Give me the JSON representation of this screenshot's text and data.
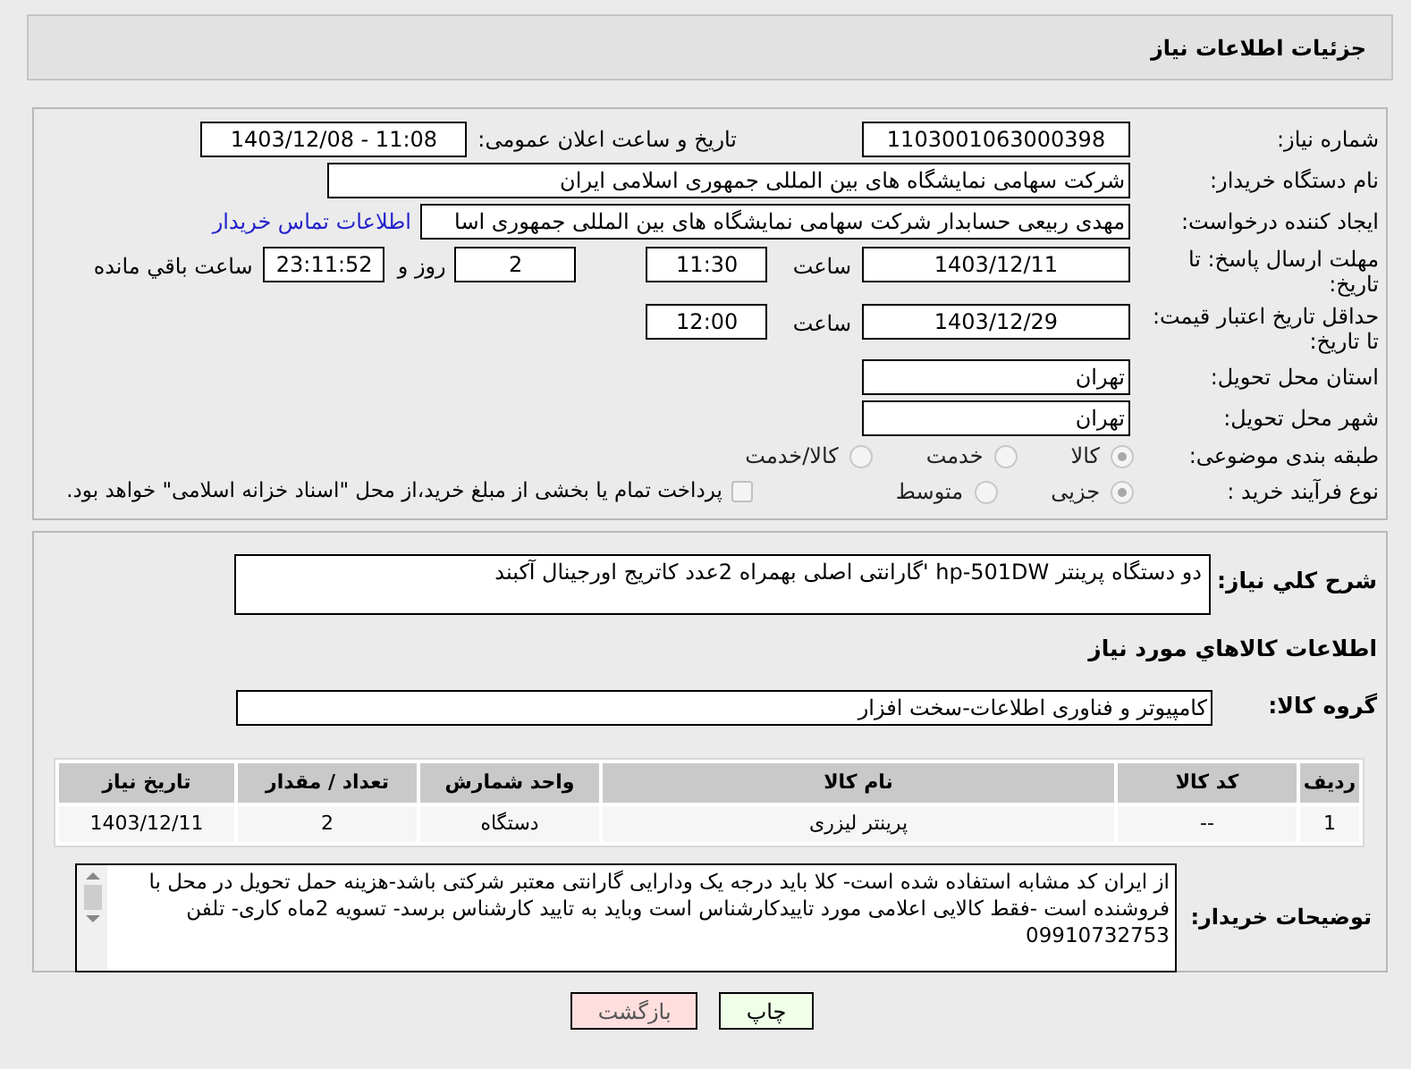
{
  "header": {
    "title": "جزئیات اطلاعات نیاز"
  },
  "need_number": {
    "label": "شماره نیاز:",
    "value": "1103001063000398"
  },
  "announce": {
    "label": "تاریخ و ساعت اعلان عمومی:",
    "value": "1403/12/08 - 11:08"
  },
  "buyer_org": {
    "label": "نام دستگاه خریدار:",
    "value": "شرکت سهامی نمایشگاه های بین المللی جمهوری اسلامی ایران"
  },
  "requester": {
    "label": "ایجاد کننده درخواست:",
    "value": "مهدی  ربیعی حسابدار شرکت سهامی نمایشگاه های بین المللی جمهوری اسا",
    "contact_link": "اطلاعات تماس خریدار"
  },
  "reply_deadline": {
    "label": "مهلت ارسال پاسخ: تا تاریخ:",
    "date": "1403/12/11",
    "time_label": "ساعت",
    "time": "11:30",
    "days": "2",
    "days_label": "روز و",
    "remaining": "23:11:52",
    "remaining_label": "ساعت باقي مانده"
  },
  "price_validity": {
    "label": "حداقل تاریخ اعتبار قیمت: تا تاریخ:",
    "date": "1403/12/29",
    "time_label": "ساعت",
    "time": "12:00"
  },
  "province": {
    "label": "استان محل تحویل:",
    "value": "تهران"
  },
  "city": {
    "label": "شهر محل تحویل:",
    "value": "تهران"
  },
  "category": {
    "label": "طبقه بندی موضوعی:",
    "options": [
      {
        "label": "کالا",
        "selected": true
      },
      {
        "label": "خدمت",
        "selected": false
      },
      {
        "label": "کالا/خدمت",
        "selected": false
      }
    ]
  },
  "purchase_type": {
    "label": "نوع فرآیند خرید :",
    "options": [
      {
        "label": "جزیی",
        "selected": true
      },
      {
        "label": "متوسط",
        "selected": false
      }
    ],
    "payment": {
      "label": "پرداخت تمام یا بخشی از مبلغ خرید،از محل \"اسناد خزانه اسلامی\" خواهد بود.",
      "checked": false
    }
  },
  "summary": {
    "label": "شرح کلي نياز:",
    "value": "دو دستگاه پرینتر hp-501DW 'گارانتی اصلی بهمراه 2عدد کاتریج اورجینال آکبند"
  },
  "goods_title": "اطلاعات کالاهاي مورد نياز",
  "goods_group": {
    "label": "گروه کالا:",
    "value": "کامپیوتر و فناوری اطلاعات-سخت افزار"
  },
  "table": {
    "columns": [
      "ردیف",
      "کد کالا",
      "نام کالا",
      "واحد شمارش",
      "تعداد / مقدار",
      "تاریخ نیاز"
    ],
    "rows": [
      [
        "1",
        "--",
        "پرینتر لیزری",
        "دستگاه",
        "2",
        "1403/12/11"
      ]
    ]
  },
  "buyer_notes": {
    "label": "توضیحات خریدار:",
    "value": "از ایران کد مشابه استفاده شده است- کلا باید درجه یک  ودارایی گارانتی معتبر شرکتی باشد-هزینه حمل تحویل در محل با فروشنده است -فقط کالایی اعلامی مورد تاییدکارشناس  است وباید به تایید کارشناس برسد- تسویه 2ماه کاری- تلفن 09910732753"
  },
  "buttons": [
    {
      "label": "چاپ",
      "kind": "print"
    },
    {
      "label": "بازگشت",
      "kind": "back"
    }
  ]
}
